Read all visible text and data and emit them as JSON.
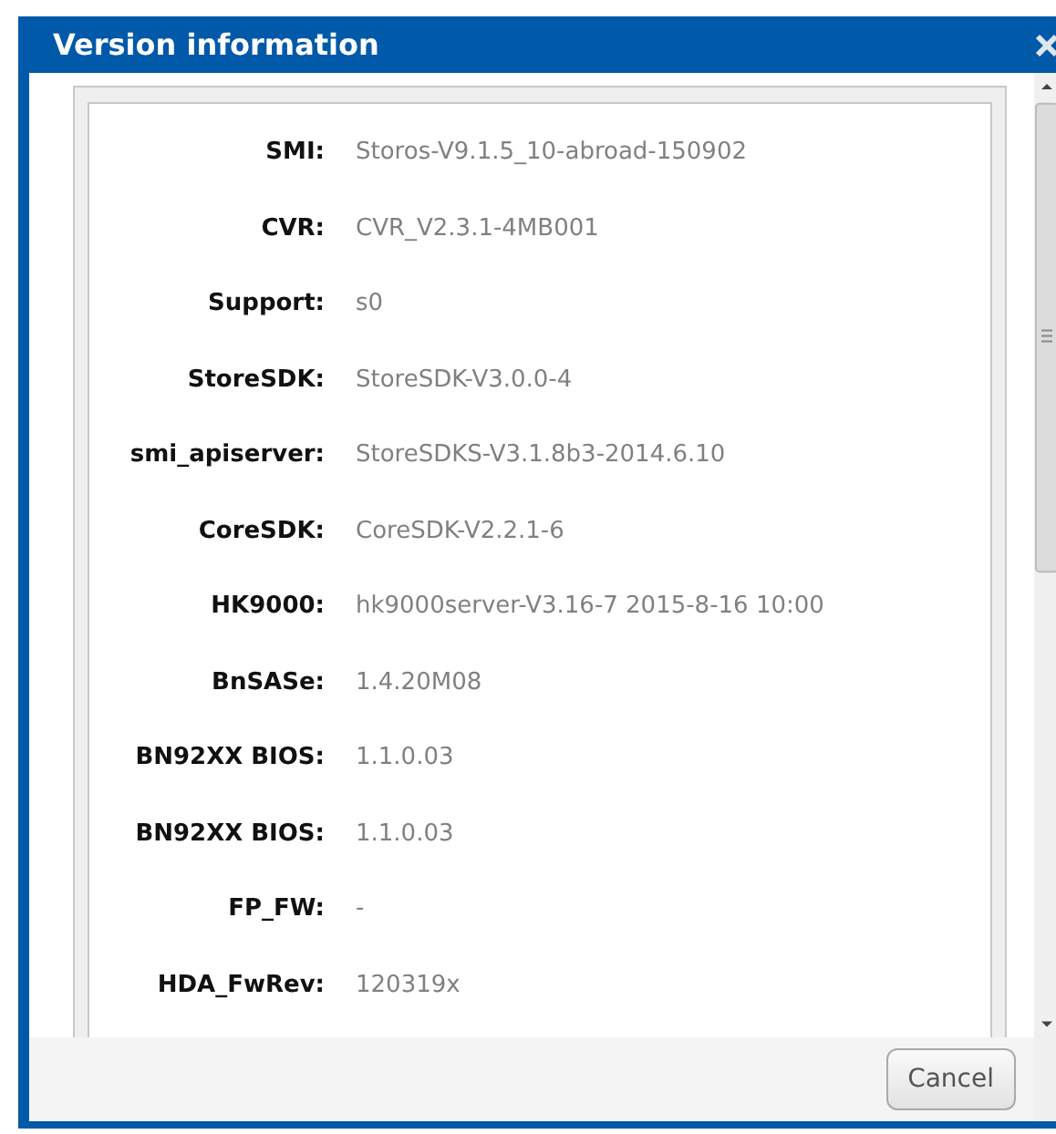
{
  "dialog": {
    "title": "Version information",
    "rows": [
      {
        "label": "SMI:",
        "value": "Storos-V9.1.5_10-abroad-150902"
      },
      {
        "label": "CVR:",
        "value": "CVR_V2.3.1-4MB001"
      },
      {
        "label": "Support:",
        "value": "s0"
      },
      {
        "label": "StoreSDK:",
        "value": "StoreSDK-V3.0.0-4"
      },
      {
        "label": "smi_apiserver:",
        "value": "StoreSDKS-V3.1.8b3-2014.6.10"
      },
      {
        "label": "CoreSDK:",
        "value": "CoreSDK-V2.2.1-6"
      },
      {
        "label": "HK9000:",
        "value": "hk9000server-V3.16-7 2015-8-16 10:00"
      },
      {
        "label": "BnSASe:",
        "value": "1.4.20M08"
      },
      {
        "label": "BN92XX BIOS:",
        "value": "1.1.0.03"
      },
      {
        "label": "BN92XX BIOS:",
        "value": "1.1.0.03"
      },
      {
        "label": "FP_FW:",
        "value": "-"
      },
      {
        "label": "HDA_FwRev:",
        "value": "120319x"
      }
    ],
    "buttons": [
      "Cancel"
    ]
  }
}
